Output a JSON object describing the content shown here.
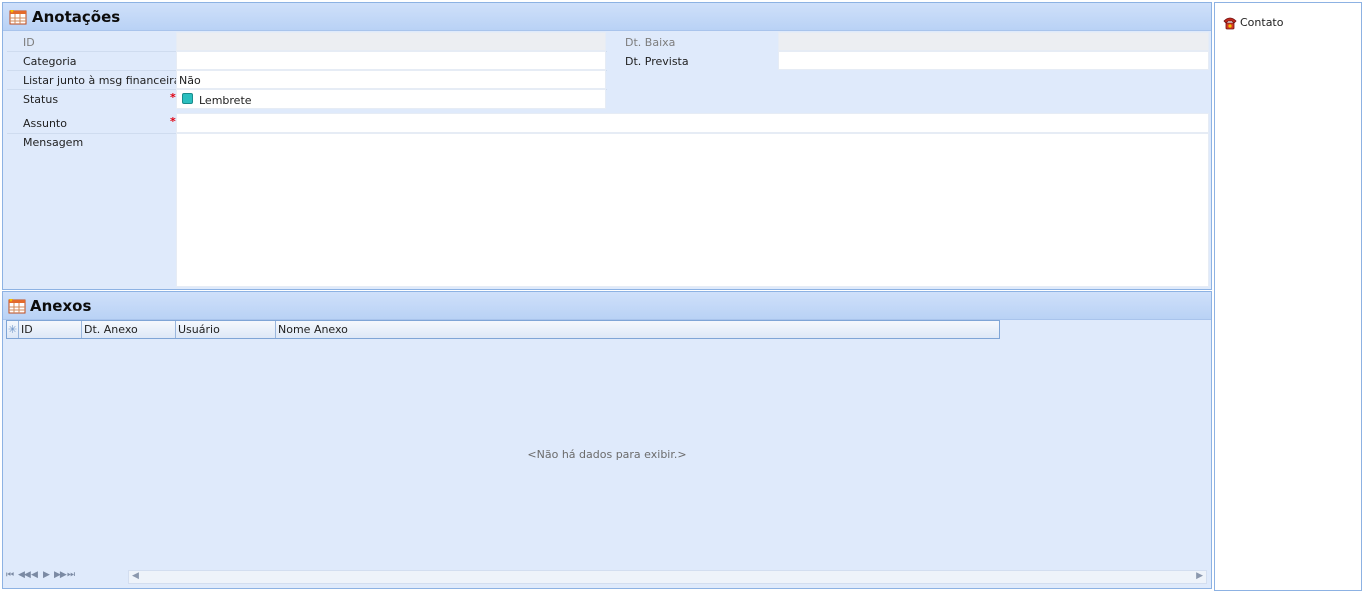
{
  "anotacoes": {
    "title": "Anotações",
    "fields": {
      "id_label": "ID",
      "categoria_label": "Categoria",
      "listar_label": "Listar junto à msg financeira",
      "listar_value": "Não",
      "status_label": "Status",
      "status_value": "Lembrete",
      "assunto_label": "Assunto",
      "mensagem_label": "Mensagem",
      "dt_baixa_label": "Dt. Baixa",
      "dt_prevista_label": "Dt. Prevista",
      "required_mark": "*"
    },
    "status_color": "#2bbfbf"
  },
  "anexos": {
    "title": "Anexos",
    "columns": [
      "ID",
      "Dt. Anexo",
      "Usuário",
      "Nome Anexo"
    ],
    "empty_text": "<Não há dados para exibir.>",
    "nav": [
      "⏮",
      "◀◀",
      "◀",
      "▶",
      "▶▶",
      "⏭"
    ]
  },
  "side": {
    "contato_label": "Contato"
  },
  "colors": {
    "panel_bg": "#dfeafb",
    "panel_border": "#8db2e3",
    "required": "#e2000f"
  }
}
